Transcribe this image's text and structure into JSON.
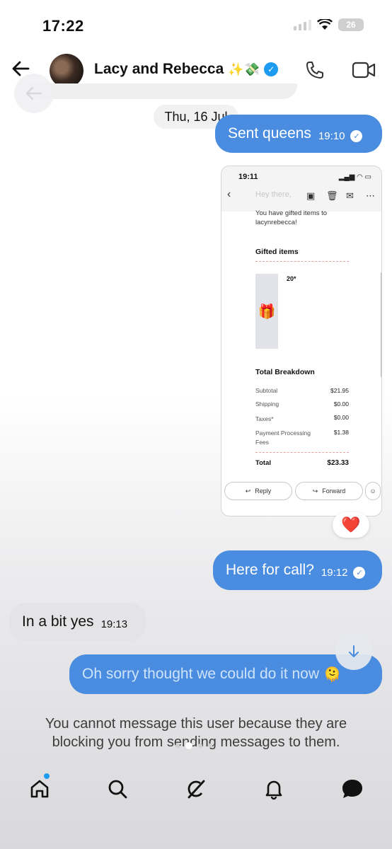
{
  "status_bar": {
    "time": "17:22",
    "battery": "26"
  },
  "header": {
    "title": "Lacy and Rebecca",
    "title_emoji": "✨💸",
    "verified_mark": "✓"
  },
  "date_divider": "Thu, 16 Jul",
  "messages": [
    {
      "dir": "out",
      "text": "Sent queens",
      "time": "19:10"
    },
    {
      "dir": "out",
      "text": "Here for call?",
      "time": "19:12"
    },
    {
      "dir": "in",
      "text": "In a bit yes",
      "time": "19:13"
    },
    {
      "dir": "out",
      "text": "Oh sorry thought we could do it now",
      "emoji": "🫠"
    }
  ],
  "shared_screenshot": {
    "time": "19:11",
    "header_faded": "Hey there,",
    "intro": "You have gifted items to lacynrebecca!",
    "gifted_heading": "Gifted items",
    "gift_qty": "20*",
    "breakdown_heading": "Total Breakdown",
    "rows": [
      {
        "label": "Subtotal",
        "value": "$21.95"
      },
      {
        "label": "Shipping",
        "value": "$0.00"
      },
      {
        "label": "Taxes*",
        "value": "$0.00"
      },
      {
        "label": "Payment Processing Fees",
        "value": "$1.38"
      }
    ],
    "total_label": "Total",
    "total_value": "$23.33",
    "reply_label": "Reply",
    "forward_label": "Forward"
  },
  "reaction": "❤️",
  "blocked_notice": "You cannot message this user because they are blocking you from sending messages to them.",
  "colors": {
    "outgoing_bubble": "#4a8de0",
    "incoming_bubble": "#e4e4e6",
    "accent": "#1d9bf0"
  },
  "nav": [
    "home-icon",
    "search-icon",
    "grok-icon",
    "notifications-icon",
    "messages-icon"
  ]
}
